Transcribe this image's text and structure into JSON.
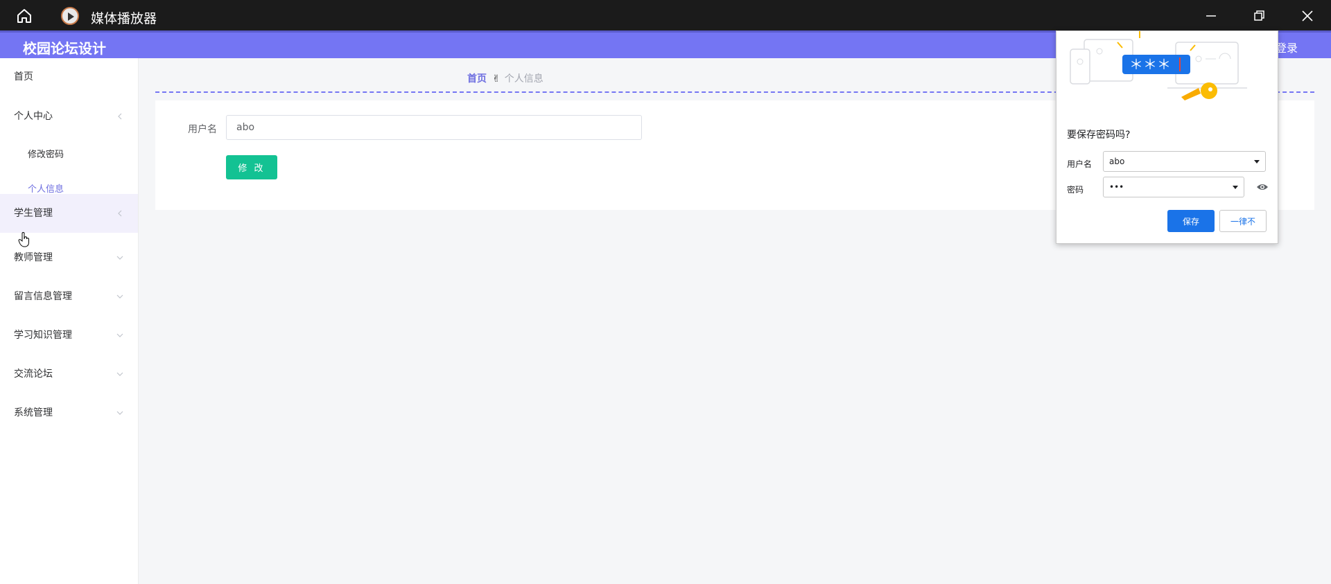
{
  "titlebar": {
    "title": "媒体播放器"
  },
  "app": {
    "brand": "校园论坛设计",
    "login": "登录"
  },
  "sidebar": {
    "items": [
      {
        "label": "首页"
      },
      {
        "label": "个人中心"
      },
      {
        "label": "修改密码"
      },
      {
        "label": "个人信息"
      },
      {
        "label": "学生管理"
      },
      {
        "label": "教师管理"
      },
      {
        "label": "留言信息管理"
      },
      {
        "label": "学习知识管理"
      },
      {
        "label": "交流论坛"
      },
      {
        "label": "系统管理"
      }
    ]
  },
  "breadcrumb": {
    "home": "首页",
    "separator": "✌",
    "current": "个人信息"
  },
  "form": {
    "username_label": "用户名",
    "username_value": "abo",
    "submit_label": "修 改"
  },
  "password_popup": {
    "stars": "＊＊＊",
    "title": "要保存密码吗?",
    "username_label": "用户名",
    "username_value": "abo",
    "password_label": "密码",
    "password_value": "•••",
    "save_label": "保存",
    "never_label": "一律不"
  },
  "colors": {
    "accent": "#7475f3",
    "submit": "#13c293",
    "popup_primary": "#1a73e8"
  }
}
